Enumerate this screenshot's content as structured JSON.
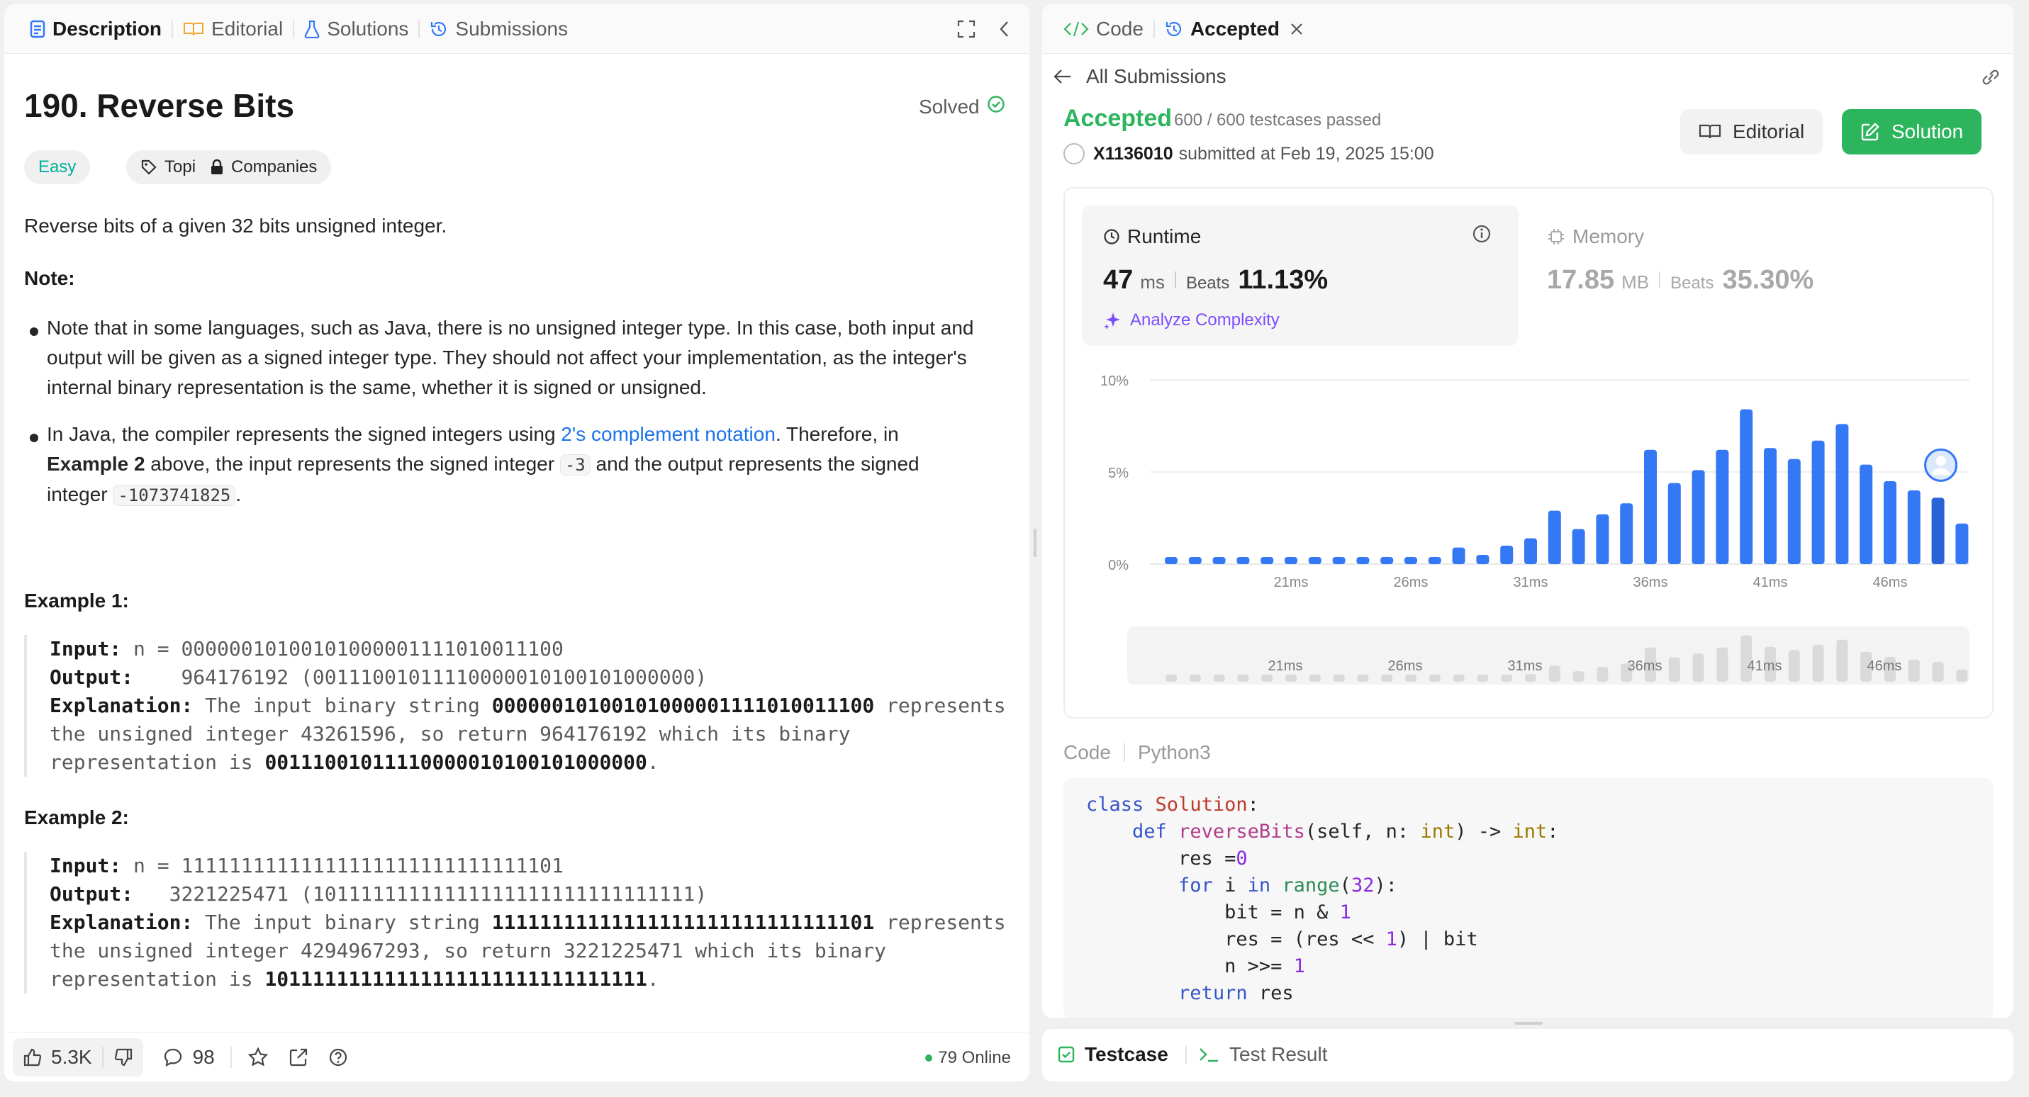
{
  "left_tabs": [
    "Description",
    "Editorial",
    "Solutions",
    "Submissions"
  ],
  "problem": {
    "title": "190. Reverse Bits",
    "solved": "Solved",
    "difficulty": "Easy",
    "topics": "Topics",
    "companies": "Companies",
    "intro": "Reverse bits of a given 32 bits unsigned integer.",
    "note": "Note:",
    "b1": "Note that in some languages, such as Java, there is no unsigned integer type. In this case, both input and output will be given as a signed integer type. They should not affect your implementation, as the integer's internal binary representation is the same, whether it is signed or unsigned.",
    "b2_pre": "In Java, the compiler represents the signed integers using ",
    "b2_link": "2's complement notation",
    "b2_post": ". Therefore, in ",
    "b2_bold": "Example 2",
    "b2_mid": " above, the input represents the signed integer ",
    "b2_code1": "-3",
    "b2_mid2": " and the output represents the signed integer ",
    "b2_code2": "-1073741825",
    "b2_end": "."
  },
  "ex1": {
    "h": "Example 1:",
    "in_l": "Input:",
    "in_v": " n = 00000010100101000001111010011100",
    "out_l": "Output:",
    "out_v": "    964176192 (00111001011110000010100101000000)",
    "exp_l": "Explanation:",
    "exp_a": " The input binary string ",
    "exp_b": "00000010100101000001111010011100",
    "exp_c": " represents",
    "line2": "the unsigned integer 43261596, so return 964176192 which its binary",
    "line3a": "representation is ",
    "line3b": "00111001011110000010100101000000",
    "line3c": "."
  },
  "ex2": {
    "h": "Example 2:",
    "in_l": "Input:",
    "in_v": " n = 11111111111111111111111111111101",
    "out_l": "Output:",
    "out_v": "   3221225471 (10111111111111111111111111111111)",
    "exp_l": "Explanation:",
    "exp_a": " The input binary string ",
    "exp_b": "11111111111111111111111111111101",
    "exp_c": " represents",
    "line2": "the unsigned integer 4294967293, so return 3221225471 which its binary",
    "line3a": "representation is ",
    "line3b": "10111111111111111111111111111111",
    "line3c": "."
  },
  "footer": {
    "likes": "5.3K",
    "comments": "98",
    "online": "79 Online"
  },
  "right_tabs": {
    "code": "Code",
    "accepted": "Accepted"
  },
  "submission": {
    "back": "All Submissions",
    "status": "Accepted",
    "tests": "600 / 600 testcases passed",
    "user": "X1136010",
    "submitted": "submitted at Feb 19, 2025 15:00",
    "editorial_btn": "Editorial",
    "solution_btn": "Solution"
  },
  "runtime": {
    "label": "Runtime",
    "value": "47",
    "unit": "ms",
    "beats_label": "Beats",
    "beats": "11.13%",
    "analyze": "Analyze Complexity"
  },
  "memory": {
    "label": "Memory",
    "value": "17.85",
    "unit": "MB",
    "beats_label": "Beats",
    "beats": "35.30%"
  },
  "chart_data": {
    "type": "bar",
    "y_ticks": [
      "10%",
      "5%",
      "0%"
    ],
    "ylim": [
      0,
      10
    ],
    "x_tick_labels": [
      "21ms",
      "26ms",
      "31ms",
      "36ms",
      "41ms",
      "46ms"
    ],
    "x": [
      16,
      17,
      18,
      19,
      20,
      21,
      22,
      23,
      24,
      25,
      26,
      27,
      28,
      29,
      30,
      31,
      32,
      33,
      34,
      35,
      36,
      37,
      38,
      39,
      40,
      41,
      42,
      43,
      44,
      45,
      46,
      47,
      48,
      49
    ],
    "values": [
      0.2,
      0.2,
      0.2,
      0.2,
      0.2,
      0.2,
      0.2,
      0.2,
      0.2,
      0.2,
      0.2,
      0.2,
      0.9,
      0.5,
      1.0,
      1.4,
      2.9,
      1.9,
      2.7,
      3.3,
      6.2,
      4.4,
      5.1,
      6.2,
      8.4,
      6.3,
      5.7,
      6.7,
      7.6,
      5.4,
      4.5,
      4.0,
      3.6,
      2.2
    ],
    "highlight_x": 48
  },
  "code_section": {
    "label": "Code",
    "lang": "Python3"
  },
  "bottom": {
    "testcase": "Testcase",
    "result": "Test Result"
  },
  "colors": {
    "accent_green": "#2db55d",
    "bar_blue": "#3478f6",
    "link_blue": "#1a73e8",
    "easy_teal": "#00af9b"
  }
}
